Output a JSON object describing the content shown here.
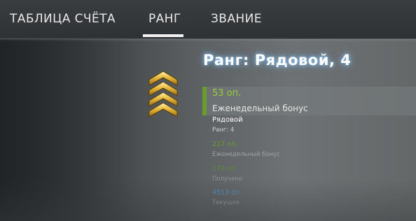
{
  "tabs": [
    {
      "label": "ТАБЛИЦА СЧЁТА",
      "active": false
    },
    {
      "label": "РАНГ",
      "active": true
    },
    {
      "label": "ЗВАНИЕ",
      "active": false
    }
  ],
  "rank": {
    "title": "Ранг: Рядовой, 4",
    "emblem": "gold-chevrons-icon"
  },
  "xp": {
    "highlight": {
      "points": "53 оп.",
      "label": "Еженедельный бонус",
      "accent": "#6a9c2a"
    },
    "rank_name": "Рядовой",
    "rank_level": "Ранг: 4",
    "rows": [
      {
        "points": "217 оп.",
        "label": "Еженедельный бонус",
        "color": "#6a9a2c"
      },
      {
        "points": "270 оп.",
        "label": "Получено",
        "color": "#5e8a34"
      },
      {
        "points": "4513 оп.",
        "label": "Текущее",
        "color": "#4a86b0"
      }
    ]
  }
}
